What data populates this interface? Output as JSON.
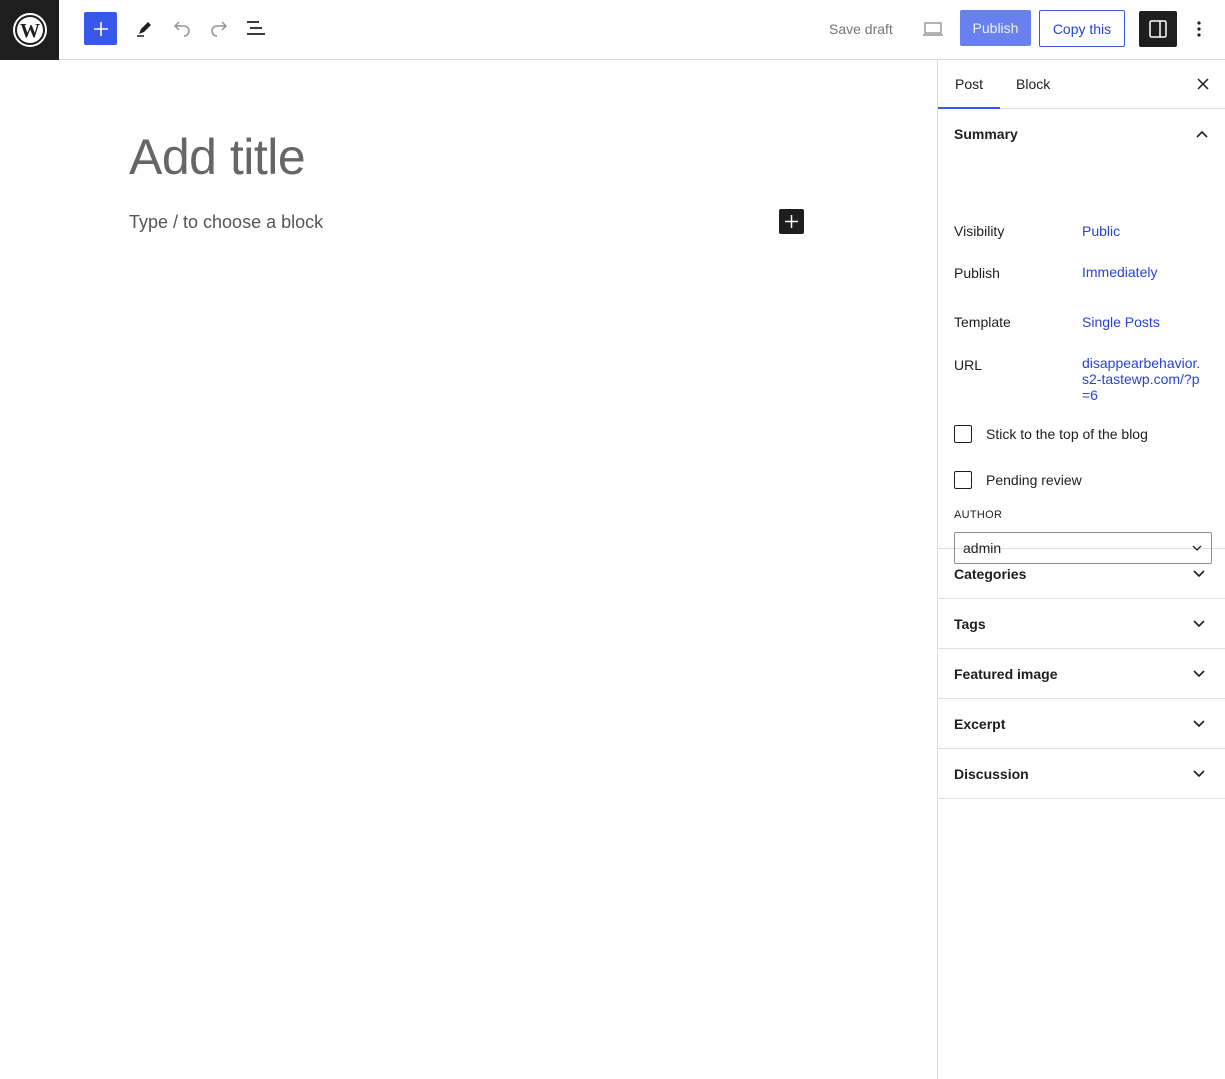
{
  "toolbar": {
    "save_draft": "Save draft",
    "publish": "Publish",
    "copy_this": "Copy this"
  },
  "editor": {
    "title_placeholder": "Add title",
    "block_placeholder": "Type / to choose a block"
  },
  "sidebar": {
    "tabs": [
      "Post",
      "Block"
    ],
    "summary": {
      "heading": "Summary",
      "rows": [
        {
          "label": "Visibility",
          "value": "Public"
        },
        {
          "label": "Publish",
          "value": "Immediately"
        },
        {
          "label": "Template",
          "value": "Single Posts"
        },
        {
          "label": "URL",
          "value": "disappearbehavior.s2-tastewp.com/?p=6"
        }
      ],
      "stick_to_top": "Stick to the top of the blog",
      "pending_review": "Pending review",
      "author_label": "AUTHOR",
      "author_value": "admin"
    },
    "panels": [
      "Categories",
      "Tags",
      "Featured image",
      "Excerpt",
      "Discussion"
    ]
  },
  "colors": {
    "accent": "#3858e9",
    "link": "#2744d2",
    "dark": "#1e1e1e"
  }
}
